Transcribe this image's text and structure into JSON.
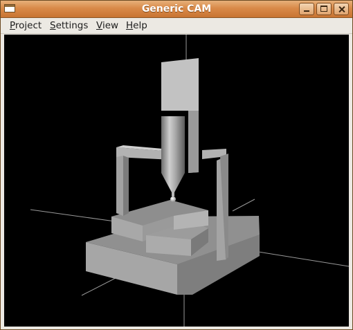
{
  "window": {
    "title": "Generic CAM"
  },
  "menu": {
    "items": [
      {
        "label": "Project"
      },
      {
        "label": "Settings"
      },
      {
        "label": "View"
      },
      {
        "label": "Help"
      }
    ]
  },
  "icons": {
    "app": "app-window-icon",
    "minimize": "minimize-icon",
    "maximize": "maximize-icon",
    "close": "close-icon"
  },
  "colors": {
    "titlebar": "#d98a49",
    "viewport_background": "#000000",
    "model_gray": "#a8a8a8"
  }
}
